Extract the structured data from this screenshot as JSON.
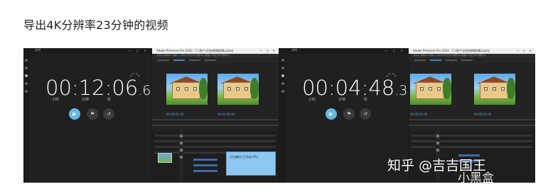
{
  "heading": "导出4K分辨率23分钟的视频",
  "screens": [
    {
      "timer": {
        "title": "计时",
        "time_main": "00:12:06",
        "time_cs": ".60",
        "unit_hours": "小时",
        "unit_minutes": "分钟",
        "unit_seconds": "秒"
      },
      "premiere": {
        "window_title": "Adobe Premiere Pro 2022 - C:\\用户\\文档\\视频剪辑.prproj",
        "menu": "文件(F) 编辑(E) 剪辑(C) 序列(S) 标记(M) 图形(G) 视图(V) 窗口(W) 帮助(H)",
        "timecode_left": "00:00:00:00",
        "timecode_right": "00:00:00:00",
        "dialog_text": "正在编码 (已完成 0%)"
      }
    },
    {
      "timer": {
        "title": "计时",
        "time_main": "00:04:48",
        "time_cs": ".39",
        "unit_hours": "小时",
        "unit_minutes": "分钟",
        "unit_seconds": "秒"
      },
      "premiere": {
        "window_title": "Adobe Premiere Pro 2022 - C:\\用户\\文档\\视频剪辑.prproj",
        "menu": "文件(F) 编辑(E) 剪辑(C) 序列(S) 标记(M) 图形(G) 视图(V) 窗口(W) 帮助(H)",
        "timecode_left": "00:00:00:00",
        "timecode_right": "00:00:00:00"
      }
    }
  ],
  "watermark": {
    "zhihu": "知乎 @吉吉国王",
    "xiaoheihe": "小黑盒"
  },
  "colors": {
    "play_button": "#61b8ea",
    "timecode": "#5aa1e0",
    "dialog_bg": "#8ec7f0"
  }
}
